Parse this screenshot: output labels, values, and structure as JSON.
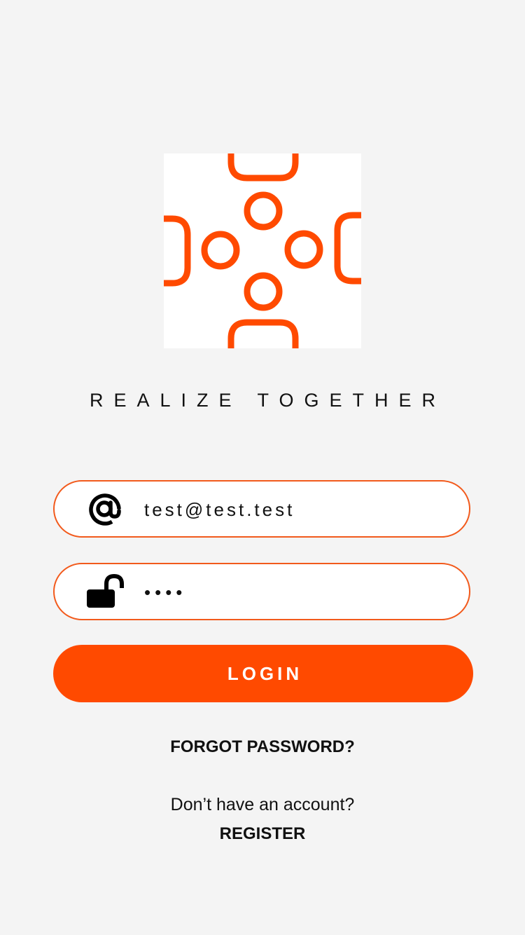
{
  "brand": {
    "tagline": "REALIZE TOGETHER",
    "accent_color": "#ff4a00",
    "border_color": "#f25a1c"
  },
  "login_form": {
    "email": {
      "icon": "at-sign-icon",
      "value": "test@test.test"
    },
    "password": {
      "icon": "unlocked-padlock-icon",
      "value": "••••"
    },
    "login_label": "LOGIN",
    "forgot_label": "FORGOT PASSWORD?"
  },
  "signup": {
    "prompt": "Don’t have an account?",
    "register_label": "REGISTER"
  }
}
